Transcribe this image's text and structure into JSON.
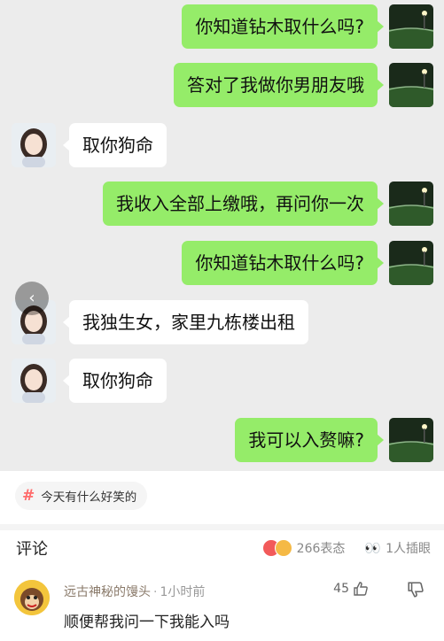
{
  "chat": {
    "messages": [
      {
        "side": "me",
        "text": "你知道钻木取什么吗?"
      },
      {
        "side": "me",
        "text": "答对了我做你男朋友哦"
      },
      {
        "side": "other",
        "text": "取你狗命"
      },
      {
        "side": "me",
        "text": "我收入全部上缴哦，再问你一次"
      },
      {
        "side": "me",
        "text": "你知道钻木取什么吗?"
      },
      {
        "side": "other",
        "text": "我独生女，家里九栋楼出租"
      },
      {
        "side": "other",
        "text": "取你狗命"
      },
      {
        "side": "me",
        "text": "我可以入赘嘛?"
      }
    ],
    "back_icon": "‹"
  },
  "topic": {
    "hash": "#",
    "label": "今天有什么好笑的"
  },
  "comments_section": {
    "title": "评论",
    "reactions_count": "266表态",
    "viewers": "1人插眼"
  },
  "comment": {
    "author": "远古神秘的馒头",
    "separator": "·",
    "time": "1小时前",
    "likes": "45",
    "text": "顺便帮我问一下我能入吗"
  },
  "colors": {
    "my_bubble": "#95ec69",
    "other_bubble": "#ffffff",
    "chat_bg": "#ececec"
  }
}
